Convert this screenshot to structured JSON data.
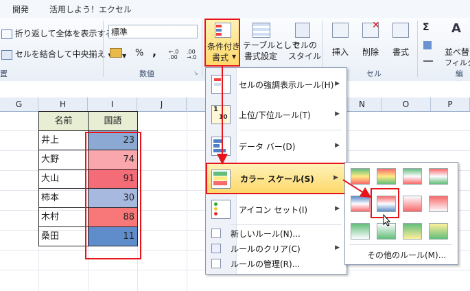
{
  "tabs": [
    "開発",
    "活用しよう！エクセル"
  ],
  "ribbon": {
    "wrap_text": "折り返して全体を表示する",
    "merge_center": "セルを結合して中央揃え",
    "number_format": "標準",
    "number_group": "数値",
    "alignment_group_partial": "置",
    "cond_format": [
      "条件付き",
      "書式"
    ],
    "table_format": [
      "テーブルとして",
      "書式設定"
    ],
    "cell_styles": [
      "セルの",
      "スタイル"
    ],
    "insert": "挿入",
    "delete": "削除",
    "format": "書式",
    "cells_group": "セル",
    "sort_filter": [
      "並べ替",
      "フィルタ"
    ],
    "edit_group_partial": "編集",
    "percent": "%",
    "comma": ",",
    "inc_decimal": "←.0 .00",
    "dec_decimal": ".00 →.0",
    "sum_symbol": "Σ"
  },
  "columns": [
    "G",
    "H",
    "I",
    "J",
    "N",
    "O",
    "P"
  ],
  "table": {
    "headers": [
      "名前",
      "国語"
    ],
    "rows": [
      {
        "name": "井上",
        "score": "23",
        "color": "#8ba9d3"
      },
      {
        "name": "大野",
        "score": "74",
        "color": "#f9a6ad"
      },
      {
        "name": "大山",
        "score": "91",
        "color": "#f36c77"
      },
      {
        "name": "柿本",
        "score": "30",
        "color": "#a8b9e0"
      },
      {
        "name": "木村",
        "score": "88",
        "color": "#f87778"
      },
      {
        "name": "桑田",
        "score": "11",
        "color": "#5f8ccb"
      }
    ]
  },
  "menu": {
    "items": [
      {
        "label": "セルの強調表示ルール(H)",
        "icon": "highlight-rules-icon"
      },
      {
        "label": "上位/下位ルール(T)",
        "icon": "top-bottom-icon"
      },
      {
        "label": "データ バー(D)",
        "icon": "data-bar-icon"
      },
      {
        "label": "カラー スケール(S)",
        "icon": "color-scale-icon"
      },
      {
        "label": "アイコン セット(I)",
        "icon": "icon-set-icon"
      }
    ],
    "small_items": [
      "新しいルール(N)...",
      "ルールのクリア(C)",
      "ルールの管理(R)..."
    ]
  },
  "submenu": {
    "more_rules": "その他のルール(M)..."
  },
  "colors": {
    "highlight_red": "#e8141b",
    "menu_hover": "#fde58a"
  }
}
